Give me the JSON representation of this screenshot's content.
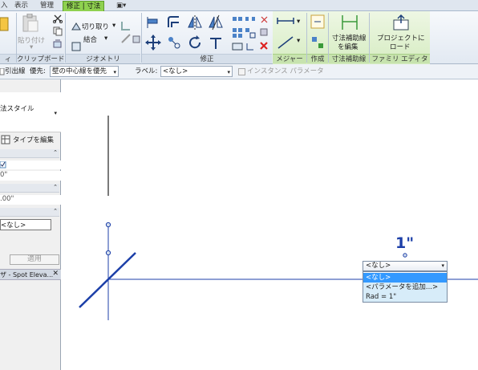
{
  "tabs": [
    {
      "label": "入"
    },
    {
      "label": "表示"
    },
    {
      "label": "管理"
    },
    {
      "label": "修正 | 寸法",
      "active": true
    },
    {
      "label": "▣▾"
    }
  ],
  "ribbon": {
    "paste_label": "貼り付け",
    "cut_label": "切り取り",
    "join_label": "結合",
    "panels": {
      "p0": "ィ",
      "clipboard": "クリップボード",
      "geometry": "ジオメトリ",
      "modify": "修正",
      "measure": "メジャー",
      "create": "作成",
      "dim_aux": "寸法補助線",
      "family_editor": "ファミリ エディタ"
    },
    "edit_witness": [
      "寸法補助線",
      "を編集"
    ],
    "load_project": [
      "プロジェクトに",
      "ロード"
    ]
  },
  "options_bar": {
    "leader_label": "引出線",
    "prefer_label": "優先:",
    "prefer_value": "壁の中心線を優先",
    "label_label": "ラベル:",
    "label_value": "<なし>",
    "instance_param": "インスタンス パラメータ"
  },
  "properties": {
    "type_name": "法スタイル",
    "edit_type": "タイプを編集",
    "val1": "0\"",
    "val2": ".00\"",
    "val3": "<なし>",
    "apply": "適用",
    "browser_title": "ザ - Spot Eleva..."
  },
  "canvas": {
    "dimension_value": "1\"",
    "label_dropdown": {
      "selected": "<なし>",
      "items": [
        "<なし>",
        "<パラメータを追加...>",
        "Rad = 1\""
      ]
    }
  },
  "colors": {
    "accent_green": "#8fd14f",
    "drawing_blue": "#1c3fa8",
    "selection_blue": "#3399ff"
  }
}
